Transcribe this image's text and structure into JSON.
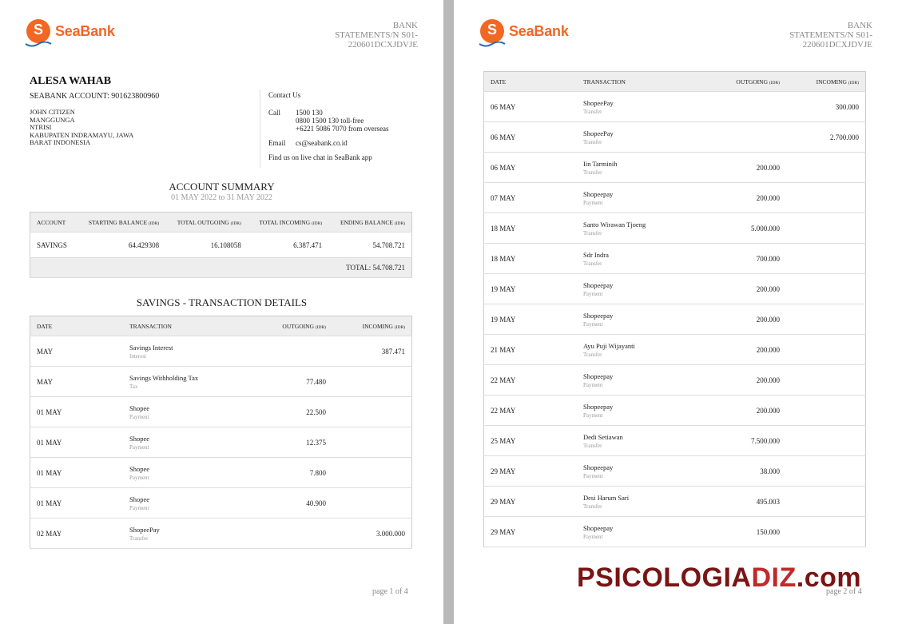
{
  "brand": {
    "name": "SeaBank",
    "color": "#f26722"
  },
  "statement_id": "BANK STATEMENTS/N S01-220601DCXJDVJE",
  "statement_lines": [
    "BANK",
    "STATEMENTS/N S01-",
    "220601DCXJDVJE"
  ],
  "customer": {
    "name": "ALESA WAHAB",
    "account": "SEABANK ACCOUNT: 901623800960",
    "address": [
      "JOHN CITIZEN",
      "MANGGUNGA",
      "NTRISI",
      "KABUPATEN INDRAMAYU, JAWA",
      "BARAT INDONESIA"
    ]
  },
  "contact": {
    "title": "Contact Us",
    "call_label": "Call",
    "call_lines": [
      "1500 130",
      "0800 1500 130 toll-free",
      "+6221 5086 7070 from overseas"
    ],
    "email_label": "Email",
    "email": "cs@seabank.co.id",
    "chat": "Find us on live chat in SeaBank app"
  },
  "summary": {
    "title": "ACCOUNT SUMMARY",
    "period": "01 MAY 2022 to 31 MAY 2022",
    "unit": "(IDR)",
    "headers": {
      "account": "ACCOUNT",
      "starting": "STARTING BALANCE",
      "outgoing": "TOTAL OUTGOING",
      "incoming": "TOTAL INCOMING",
      "ending": "ENDING BALANCE"
    },
    "row": {
      "account": "SAVINGS",
      "starting": "64.429308",
      "outgoing": "16.108058",
      "incoming": "6.387.471",
      "ending": "54.708.721"
    },
    "total": "TOTAL: 54.708.721"
  },
  "details": {
    "title": "SAVINGS - TRANSACTION DETAILS",
    "headers": {
      "date": "DATE",
      "transaction": "TRANSACTION",
      "outgoing": "OUTGOING",
      "incoming": "INCOMING",
      "unit": "(IDR)"
    },
    "page1_rows": [
      {
        "date": "MAY",
        "name": "Savings Interest",
        "type": "Interest",
        "out": "",
        "in": "387.471"
      },
      {
        "date": "MAY",
        "name": "Savings Withholding Tax",
        "type": "Tax",
        "out": "77.480",
        "in": ""
      },
      {
        "date": "01 MAY",
        "name": "Shopee",
        "type": "Payment",
        "out": "22.500",
        "in": ""
      },
      {
        "date": "01 MAY",
        "name": "Shopee",
        "type": "Payment",
        "out": "12.375",
        "in": ""
      },
      {
        "date": "01 MAY",
        "name": "Shopee",
        "type": "Payment",
        "out": "7.800",
        "in": ""
      },
      {
        "date": "01 MAY",
        "name": "Shopee",
        "type": "Payment",
        "out": "40.900",
        "in": ""
      },
      {
        "date": "02 MAY",
        "name": "ShopeePay",
        "type": "Transfer",
        "out": "",
        "in": "3.000.000"
      }
    ],
    "page2_rows": [
      {
        "date": "06 MAY",
        "name": "ShopeePay",
        "type": "Transfer",
        "out": "",
        "in": "300.000"
      },
      {
        "date": "06 MAY",
        "name": "ShopeePay",
        "type": "Transfer",
        "out": "",
        "in": "2.700.000"
      },
      {
        "date": "06 MAY",
        "name": "Iin Tarminih",
        "type": "Transfer",
        "out": "200.000",
        "in": ""
      },
      {
        "date": "07 MAY",
        "name": "Shopeepay",
        "type": "Payment",
        "out": "200.000",
        "in": ""
      },
      {
        "date": "18 MAY",
        "name": "Santo Wirawan Tjoeng",
        "type": "Transfer",
        "out": "5.000.000",
        "in": ""
      },
      {
        "date": "18 MAY",
        "name": "Sdr Indra",
        "type": "Transfer",
        "out": "700.000",
        "in": ""
      },
      {
        "date": "19 MAY",
        "name": "Shopeepay",
        "type": "Payment",
        "out": "200.000",
        "in": ""
      },
      {
        "date": "19 MAY",
        "name": "Shopeepay",
        "type": "Payment",
        "out": "200.000",
        "in": ""
      },
      {
        "date": "21 MAY",
        "name": "Ayu Puji Wijayanti",
        "type": "Transfer",
        "out": "200.000",
        "in": ""
      },
      {
        "date": "22 MAY",
        "name": "Shopeepay",
        "type": "Payment",
        "out": "200.000",
        "in": ""
      },
      {
        "date": "22 MAY",
        "name": "Shopeepay",
        "type": "Payment",
        "out": "200.000",
        "in": ""
      },
      {
        "date": "25 MAY",
        "name": "Dedi Setiawan",
        "type": "Transfer",
        "out": "7.500.000",
        "in": ""
      },
      {
        "date": "29 MAY",
        "name": "Shopeepay",
        "type": "Payment",
        "out": "38.000",
        "in": ""
      },
      {
        "date": "29 MAY",
        "name": "Desi Harum Sari",
        "type": "Transfer",
        "out": "495.003",
        "in": ""
      },
      {
        "date": "29 MAY",
        "name": "Shopeepay",
        "type": "Payment",
        "out": "150.000",
        "in": ""
      }
    ]
  },
  "pages": {
    "p1": "page 1 of 4",
    "p2": "page 2 of 4"
  },
  "watermark": {
    "pre": "PSICOLOGIA",
    "highlight": "DIZ",
    "post": ".com"
  }
}
